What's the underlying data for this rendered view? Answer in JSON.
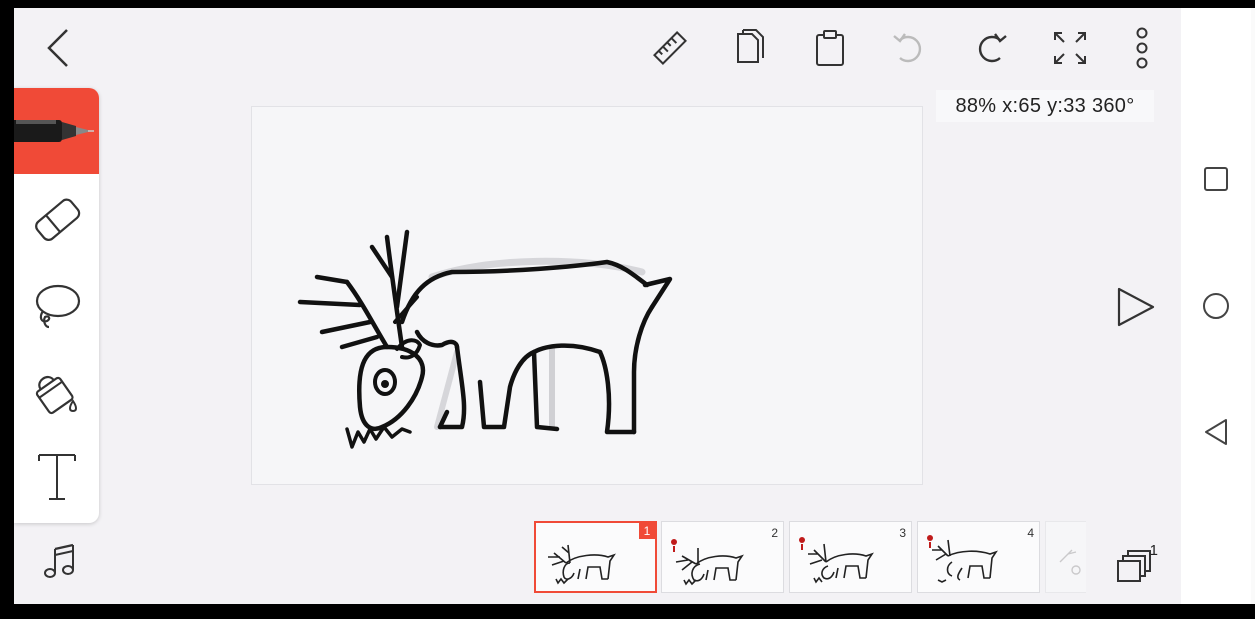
{
  "toolbar": {
    "icons": [
      "back-icon",
      "ruler-icon",
      "duplicate-icon",
      "clipboard-icon",
      "undo-icon",
      "redo-icon",
      "fullscreen-icon",
      "more-icon"
    ]
  },
  "status": {
    "text": "88% x:65 y:33 360°"
  },
  "tools": [
    {
      "name": "pen",
      "icon": "pen-icon",
      "active": true
    },
    {
      "name": "eraser",
      "icon": "eraser-icon",
      "active": false
    },
    {
      "name": "lasso",
      "icon": "lasso-icon",
      "active": false
    },
    {
      "name": "fill",
      "icon": "paint-bucket-icon",
      "active": false
    },
    {
      "name": "text",
      "icon": "text-icon",
      "active": false
    }
  ],
  "music": {
    "icon": "music-note-icon"
  },
  "timeline": {
    "frames": [
      {
        "number": "1",
        "selected": true
      },
      {
        "number": "2",
        "selected": false
      },
      {
        "number": "3",
        "selected": false
      },
      {
        "number": "4",
        "selected": false
      }
    ],
    "layers_count": "1"
  },
  "playback": {
    "icon": "play-icon"
  },
  "system_nav": {
    "icons": [
      "square-icon",
      "circle-home-icon",
      "triangle-back-icon"
    ]
  },
  "colors": {
    "accent": "#f04a37",
    "background": "#f3f2f5",
    "ink": "#111111"
  }
}
